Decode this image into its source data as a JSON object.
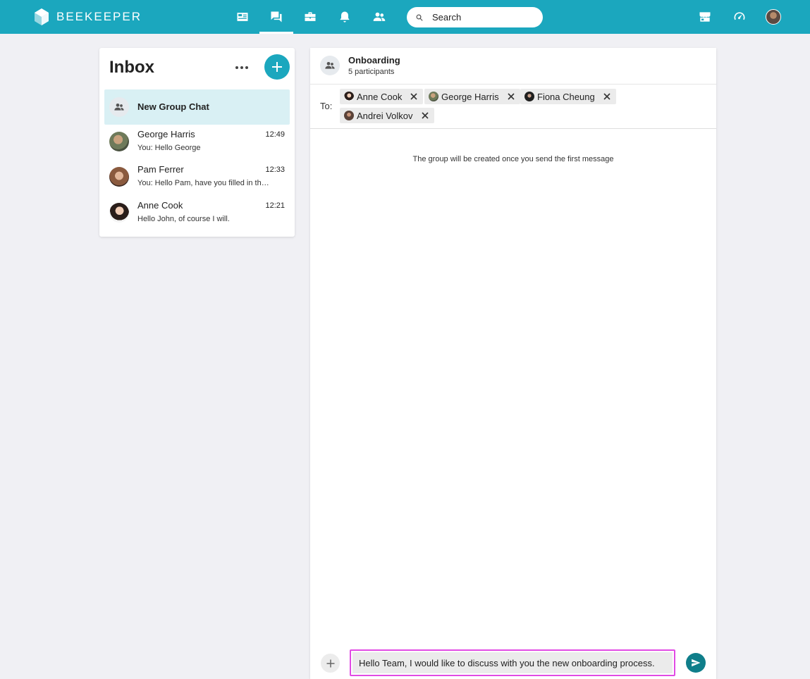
{
  "app": {
    "brand": "BEEKEEPER"
  },
  "nav": {
    "items": [
      {
        "icon": "news-icon",
        "active": false
      },
      {
        "icon": "chat-icon",
        "active": true
      },
      {
        "icon": "toolbox-icon",
        "active": false
      },
      {
        "icon": "bell-icon",
        "active": false
      },
      {
        "icon": "people-icon",
        "active": false
      }
    ],
    "search_placeholder": "Search",
    "right_icons": [
      "store-icon",
      "dashboard-icon"
    ]
  },
  "inbox": {
    "title": "Inbox",
    "new_group_label": "New Group Chat",
    "conversations": [
      {
        "name": "George Harris",
        "time": "12:49",
        "preview": "You: Hello George"
      },
      {
        "name": "Pam Ferrer",
        "time": "12:33",
        "preview": "You: Hello Pam, have you filled in the form?"
      },
      {
        "name": "Anne Cook",
        "time": "12:21",
        "preview": "Hello John, of course I will."
      }
    ]
  },
  "chat": {
    "title": "Onboarding",
    "subtitle": "5 participants",
    "to_label": "To:",
    "recipients": [
      {
        "name": "Anne Cook"
      },
      {
        "name": "George Harris"
      },
      {
        "name": "Fiona Cheung"
      },
      {
        "name": "Andrei Volkov"
      }
    ],
    "info": "The group will be created once you send the first message",
    "composer_value": "Hello Team, I would like to discuss with you the new onboarding process."
  },
  "colors": {
    "brand": "#1ba7be",
    "selected_row": "#d9f0f4",
    "send": "#0f7e8a",
    "focus_outline": "#e14be4"
  }
}
